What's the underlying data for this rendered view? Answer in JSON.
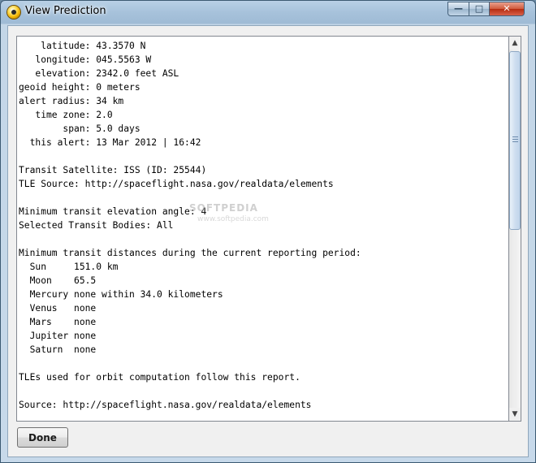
{
  "window": {
    "title": "View Prediction",
    "controls": {
      "minimize": "—",
      "maximize": "□",
      "close": "✕"
    }
  },
  "report": {
    "lines": [
      "    latitude: 43.3570 N",
      "   longitude: 045.5563 W",
      "   elevation: 2342.0 feet ASL",
      "geoid height: 0 meters",
      "alert radius: 34 km",
      "   time zone: 2.0",
      "        span: 5.0 days",
      "  this alert: 13 Mar 2012 | 16:42",
      "",
      "Transit Satellite: ISS (ID: 25544)",
      "TLE Source: http://spaceflight.nasa.gov/realdata/elements",
      "",
      "Minimum transit elevation angle: 4",
      "Selected Transit Bodies: All",
      "",
      "Minimum transit distances during the current reporting period:",
      "  Sun     151.0 km",
      "  Moon    65.5",
      "  Mercury none within 34.0 kilometers",
      "  Venus   none",
      "  Mars    none",
      "  Jupiter none",
      "  Saturn  none",
      "",
      "TLEs used for orbit computation follow this report.",
      "",
      "Source: http://spaceflight.nasa.gov/realdata/elements"
    ]
  },
  "watermark": {
    "main": "SOFTPEDIA",
    "sub": "www.softpedia.com"
  },
  "buttons": {
    "done": "Done"
  }
}
